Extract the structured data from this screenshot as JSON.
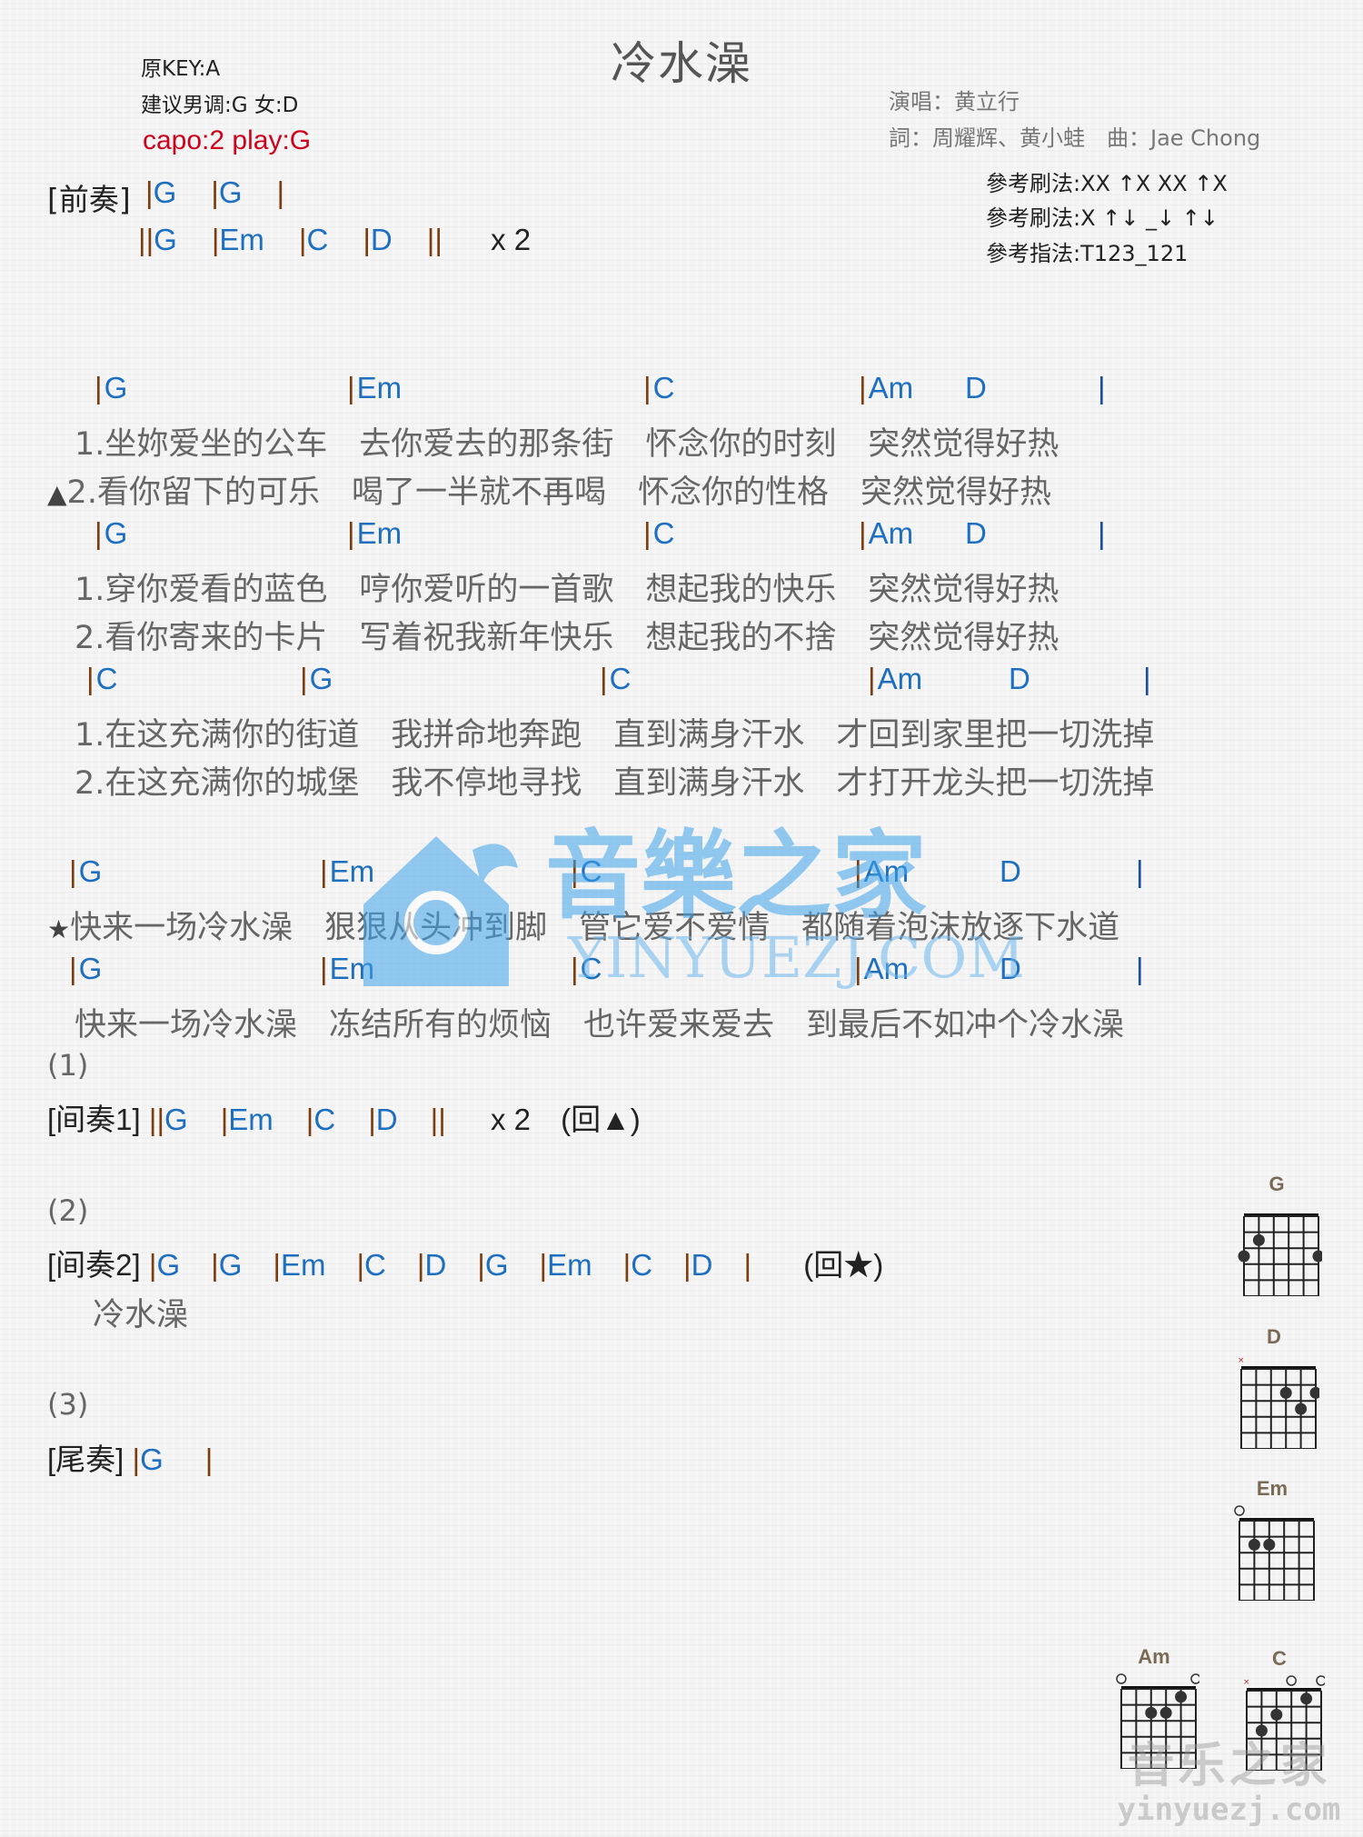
{
  "title": "冷水澡",
  "header": {
    "original_key": "原KEY:A",
    "suggested_key": "建议男调:G 女:D",
    "capo": "capo:2 play:G",
    "singer": "演唱：黄立行",
    "credits": "詞：周耀辉、黄小蛙　曲：Jae Chong",
    "strum1": "參考刷法:XX ↑X XX ↑X",
    "strum2": "參考刷法:X ↑↓ _↓ ↑↓",
    "finger": "參考指法:T123_121"
  },
  "intro": {
    "label": "[前奏]",
    "line1": [
      {
        "bar": "|",
        "chord": "G"
      },
      {
        "bar": "|",
        "chord": "G"
      },
      {
        "bar": "|",
        "chord": ""
      }
    ],
    "line2": [
      {
        "bar": "||",
        "chord": "G"
      },
      {
        "bar": "|",
        "chord": "Em"
      },
      {
        "bar": "|",
        "chord": "C"
      },
      {
        "bar": "|",
        "chord": "D"
      },
      {
        "bar": "||",
        "chord": ""
      }
    ],
    "repeat": "x 2"
  },
  "verse": [
    {
      "chords": [
        "G",
        "Em",
        "C",
        "Am",
        "D"
      ],
      "lyrics": [
        {
          "marker": "",
          "text": "1.坐妳爱坐的公车　去你爱去的那条街　怀念你的时刻　突然觉得好热"
        },
        {
          "marker": "▲",
          "text": "2.看你留下的可乐　喝了一半就不再喝　怀念你的性格　突然觉得好热"
        }
      ]
    },
    {
      "chords": [
        "G",
        "Em",
        "C",
        "Am",
        "D"
      ],
      "lyrics": [
        {
          "marker": "",
          "text": "1.穿你爱看的蓝色　哼你爱听的一首歌　想起我的快乐　突然觉得好热"
        },
        {
          "marker": "",
          "text": "2.看你寄来的卡片　写着祝我新年快乐　想起我的不捨　突然觉得好热"
        }
      ]
    },
    {
      "chords": [
        "C",
        "G",
        "C",
        "Am",
        "D"
      ],
      "lyrics": [
        {
          "marker": "",
          "text": "1.在这充满你的街道　我拼命地奔跑　直到满身汗水　才回到家里把一切洗掉"
        },
        {
          "marker": "",
          "text": "2.在这充满你的城堡　我不停地寻找　直到满身汗水　才打开龙头把一切洗掉"
        }
      ]
    }
  ],
  "chorus": [
    {
      "chords": [
        "G",
        "Em",
        "C",
        "Am",
        "D"
      ],
      "lyrics": [
        {
          "marker": "★",
          "text": "快来一场冷水澡　狠狠从头冲到脚　管它爱不爱情　都随着泡沫放逐下水道"
        }
      ]
    },
    {
      "chords": [
        "G",
        "Em",
        "C",
        "Am",
        "D"
      ],
      "lyrics": [
        {
          "marker": "",
          "text": "快来一场冷水澡　冻结所有的烦恼　也许爱来爱去　到最后不如冲个冷水澡"
        }
      ]
    }
  ],
  "interlude1": {
    "number": "(1)",
    "label": "[间奏1]",
    "chords": [
      {
        "bar": "||",
        "chord": "G"
      },
      {
        "bar": "|",
        "chord": "Em"
      },
      {
        "bar": "|",
        "chord": "C"
      },
      {
        "bar": "|",
        "chord": "D"
      },
      {
        "bar": "||",
        "chord": ""
      }
    ],
    "repeat": "x 2",
    "note": "(回▲)"
  },
  "interlude2": {
    "number": "(2)",
    "label": "[间奏2]",
    "chords": [
      {
        "bar": "|",
        "chord": "G"
      },
      {
        "bar": "|",
        "chord": "G"
      },
      {
        "bar": "|",
        "chord": "Em"
      },
      {
        "bar": "|",
        "chord": "C"
      },
      {
        "bar": "|",
        "chord": "D"
      },
      {
        "bar": "|",
        "chord": "G"
      },
      {
        "bar": "|",
        "chord": "Em"
      },
      {
        "bar": "|",
        "chord": "C"
      },
      {
        "bar": "|",
        "chord": "D"
      },
      {
        "bar": "|",
        "chord": ""
      }
    ],
    "note": "(回★)",
    "lyric": "冷水澡"
  },
  "outro": {
    "number": "(3)",
    "label": "[尾奏]",
    "chords": [
      {
        "bar": "|",
        "chord": "G"
      },
      {
        "bar": "|",
        "chord": ""
      }
    ]
  },
  "chord_diagrams": [
    {
      "name": "G",
      "muted": [],
      "open": [],
      "dots": [
        [
          2,
          2
        ],
        [
          1,
          3
        ],
        [
          6,
          3
        ]
      ]
    },
    {
      "name": "D",
      "muted": [
        1
      ],
      "open": [],
      "dots": [
        [
          4,
          2
        ],
        [
          6,
          2
        ],
        [
          5,
          3
        ]
      ]
    },
    {
      "name": "Em",
      "muted": [],
      "open": [
        1
      ],
      "dots": [
        [
          2,
          2
        ],
        [
          3,
          2
        ]
      ]
    },
    {
      "name": "Am",
      "muted": [],
      "open": [
        1,
        6
      ],
      "dots": [
        [
          5,
          1
        ],
        [
          3,
          2
        ],
        [
          4,
          2
        ]
      ]
    },
    {
      "name": "C",
      "muted": [
        1
      ],
      "open": [
        4,
        6
      ],
      "dots": [
        [
          5,
          1
        ],
        [
          3,
          2
        ],
        [
          2,
          3
        ]
      ]
    }
  ],
  "watermark": {
    "center_text": "音樂之家",
    "center_url": "YINYUEZJ.COM",
    "corner_text": "音乐之家",
    "corner_url": "yinyuezj.com"
  }
}
